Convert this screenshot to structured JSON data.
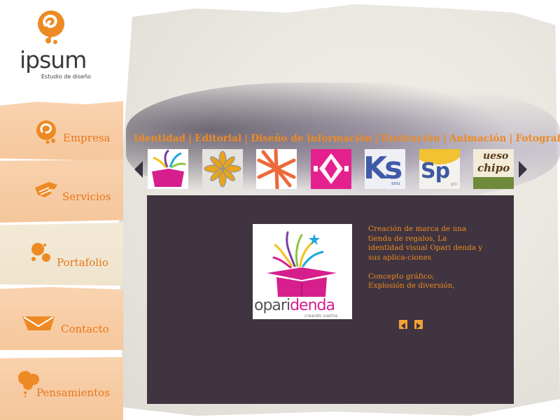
{
  "brand": {
    "name": "ipsum",
    "tagline": "Estudio de diseño",
    "accent_color": "#ee8a24",
    "panel_color": "#3f3440"
  },
  "nav": {
    "items": [
      {
        "label": "Empresa",
        "icon": "swirl-icon"
      },
      {
        "label": "Servicios",
        "icon": "hand-icon"
      },
      {
        "label": "Portafolio",
        "icon": "paint-splash-icon"
      },
      {
        "label": "Contacto",
        "icon": "envelope-icon"
      },
      {
        "label": "Pensamientos",
        "icon": "thought-bubble-icon"
      }
    ]
  },
  "categories": [
    "Identidad",
    "Editorial",
    "Diseño de información",
    "Ilustración",
    "Animación",
    "Fotografía"
  ],
  "thumbnails": [
    {
      "label": "",
      "icon": "opari-box-thumb"
    },
    {
      "label": "",
      "icon": "yellow-star-thumb"
    },
    {
      "label": "",
      "icon": "orange-knot-thumb"
    },
    {
      "label": "",
      "icon": "pink-pattern-thumb"
    },
    {
      "label": "Ks",
      "sub": "sou",
      "icon": "ks-logo-thumb"
    },
    {
      "label": "Sp",
      "sub": "po",
      "icon": "sp-logo-thumb"
    },
    {
      "label": "ueso",
      "sub": "chipo",
      "icon": "queso-logo-thumb"
    }
  ],
  "project": {
    "logo_text_left": "opari",
    "logo_text_right": "denda",
    "logo_tagline": "creando sueños",
    "description": "Creación de marca de una tienda de regalos, La identidad visual Opari denda y sus aplica-ciones",
    "concept_label": "Concepto gráfico;",
    "concept_value": "Explosión de diversión,"
  }
}
